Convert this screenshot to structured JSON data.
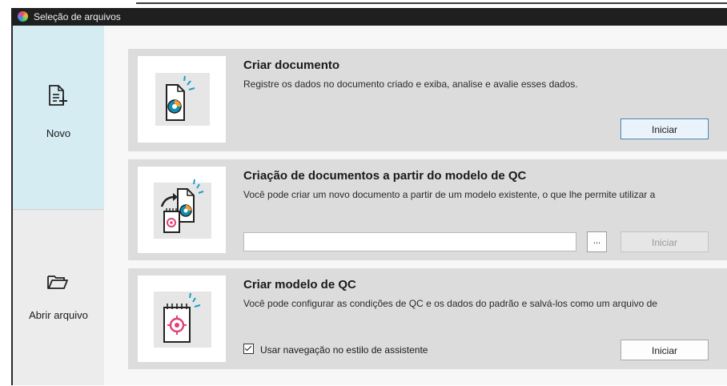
{
  "window": {
    "title": "Seleção de arquivos"
  },
  "sidebar": {
    "items": [
      {
        "label": "Novo",
        "icon": "new-document-icon",
        "selected": true
      },
      {
        "label": "Abrir arquivo",
        "icon": "folder-icon",
        "selected": false
      }
    ]
  },
  "cards": [
    {
      "title": "Criar documento",
      "description": "Registre os dados no documento criado e exiba, analise e avalie esses dados.",
      "button_label": "Iniciar",
      "icon": "document-chart-icon"
    },
    {
      "title": "Criação de documentos a partir do modelo de QC",
      "description": "Você pode criar um novo documento a partir de um modelo existente, o que lhe permite utilizar a",
      "path_value": "",
      "browse_label": "...",
      "button_label": "Iniciar",
      "button_enabled": false,
      "icon": "template-to-document-icon"
    },
    {
      "title": "Criar modelo de QC",
      "description": "Você pode configurar as condições de QC e os dados do padrão e salvá-los como um arquivo de",
      "checkbox_label": "Usar navegação no estilo de assistente",
      "checkbox_checked": true,
      "button_label": "Iniciar",
      "icon": "qc-template-icon"
    }
  ],
  "colors": {
    "sidebar_selected": "#d6ecf3",
    "card_bg": "#dcdcdc",
    "accent_blue": "#3c7fb1",
    "icon_teal": "#0f8fb3",
    "icon_orange": "#f0a030",
    "icon_pink": "#e0407a"
  }
}
